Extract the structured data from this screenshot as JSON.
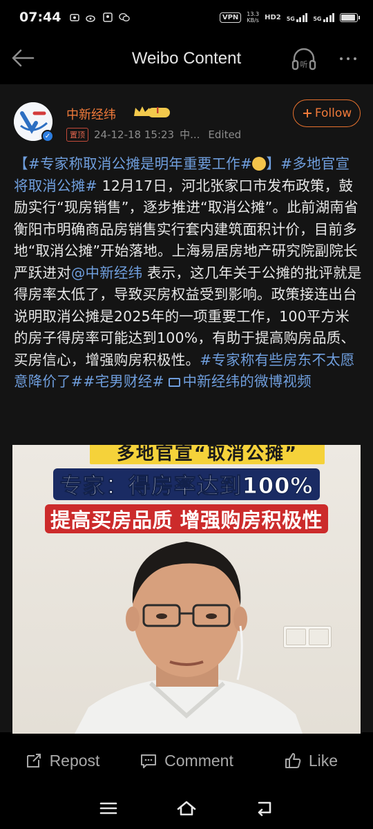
{
  "status_bar": {
    "time": "07:44",
    "vpn": "VPN",
    "speed_value": "13.3",
    "speed_unit": "KB/s",
    "hd": "HD2",
    "net1": "5G",
    "net2": "5G"
  },
  "header": {
    "title": "Weibo Content"
  },
  "post": {
    "author": "中新经纬",
    "vip_badge": "I",
    "pinned_label": "置顶",
    "timestamp": "24-12-18 15:23",
    "source": "中...",
    "edited": "Edited",
    "follow_label": "Follow",
    "text": {
      "p1_hash": "【#专家称取消公摊是明年重要工作#",
      "p1_close": "】",
      "p2_hash": "#多地官宣将取消公摊#",
      "p2_body": " 12月17日，河北张家口市发布政策，鼓励实行“现房销售”，逐步推进“取消公摊”。此前湖南省衡阳市明确商品房销售实行套内建筑面积计价，目前多地“取消公摊”开始落地。上海易居房地产研究院副院长严跃进对",
      "mention": "@中新经纬",
      "p3_body": " 表示，这几年关于公摊的批评就是得房率太低了，导致买房权益受到影响。政策接连出台说明取消公摊是2025年的一项重要工作，100平方米的房子得房率可能达到100%，有助于提高购房品质、买房信心，增强购房积极性。",
      "hash3": "#专家称有些房东不太愿意降价了#",
      "hash4": "#宅男财经#",
      "video_link": "中新经纬的微博视频"
    },
    "video": {
      "banner_top": "多地官宣“取消公摊”",
      "banner_mid": "专家：得房率达到100%",
      "banner_bottom": "提高买房品质 增强购房积极性"
    }
  },
  "actions": {
    "repost": "Repost",
    "comment": "Comment",
    "like": "Like"
  },
  "colors": {
    "accent_orange": "#f07a3a",
    "link_blue": "#6f9edd",
    "background": "#000000",
    "card": "#141414"
  }
}
